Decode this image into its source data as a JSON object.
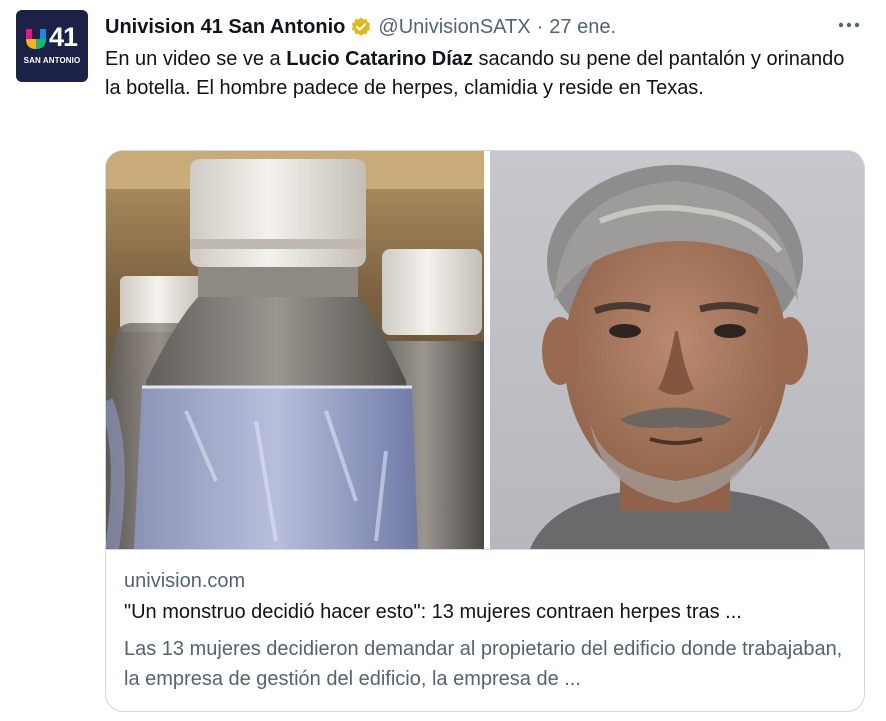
{
  "account": {
    "display_name": "Univision 41 San Antonio",
    "handle": "@UnivisionSATX",
    "separator": "·",
    "date": "27 ene.",
    "verified_badge_icon": "verified-badge-icon",
    "avatar": {
      "logo_number": "41",
      "logo_city": "SAN ANTONIO"
    }
  },
  "tweet": {
    "text_part1": "En un video se ve a ",
    "text_bold": "Lucio Catarino Díaz",
    "text_part2": " sacando su pene del pantalón y orinando la botella. El hombre padece de herpes, clamidia y reside en Texas."
  },
  "link_card": {
    "domain": "univision.com",
    "title": "\"Un monstruo decidió hacer esto\": 13 mujeres contraen herpes tras ...",
    "description": "Las 13 mujeres decidieron demandar al propietario del edificio donde trabajaban, la empresa de gestión del edificio, la empresa de ..."
  },
  "icons": {
    "more": "more-options-icon"
  },
  "colors": {
    "text_primary": "#0f1419",
    "text_secondary": "#536471",
    "verified_gold": "#e2b719",
    "border": "#cfd9de",
    "avatar_bg": "#1c2147"
  }
}
